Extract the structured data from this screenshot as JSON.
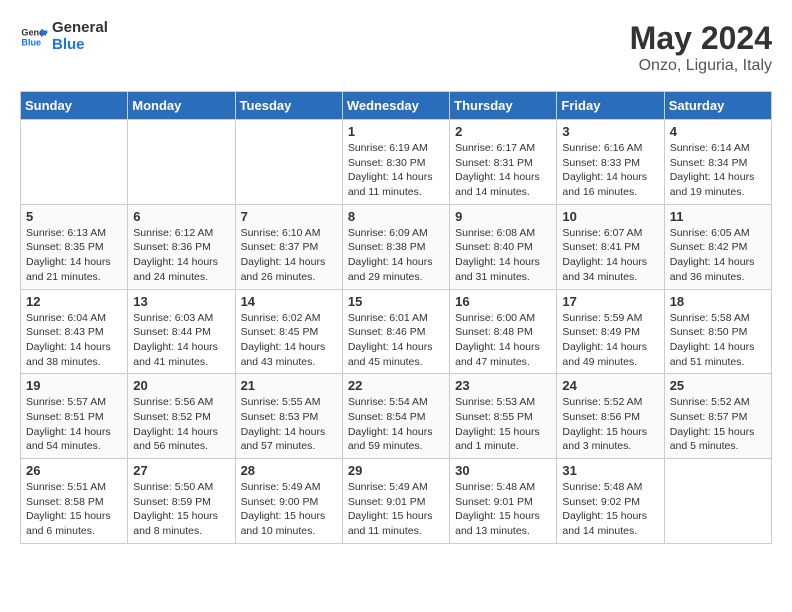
{
  "header": {
    "logo_general": "General",
    "logo_blue": "Blue",
    "month_year": "May 2024",
    "location": "Onzo, Liguria, Italy"
  },
  "days_of_week": [
    "Sunday",
    "Monday",
    "Tuesday",
    "Wednesday",
    "Thursday",
    "Friday",
    "Saturday"
  ],
  "weeks": [
    [
      {
        "day": "",
        "info": ""
      },
      {
        "day": "",
        "info": ""
      },
      {
        "day": "",
        "info": ""
      },
      {
        "day": "1",
        "info": "Sunrise: 6:19 AM\nSunset: 8:30 PM\nDaylight: 14 hours\nand 11 minutes."
      },
      {
        "day": "2",
        "info": "Sunrise: 6:17 AM\nSunset: 8:31 PM\nDaylight: 14 hours\nand 14 minutes."
      },
      {
        "day": "3",
        "info": "Sunrise: 6:16 AM\nSunset: 8:33 PM\nDaylight: 14 hours\nand 16 minutes."
      },
      {
        "day": "4",
        "info": "Sunrise: 6:14 AM\nSunset: 8:34 PM\nDaylight: 14 hours\nand 19 minutes."
      }
    ],
    [
      {
        "day": "5",
        "info": "Sunrise: 6:13 AM\nSunset: 8:35 PM\nDaylight: 14 hours\nand 21 minutes."
      },
      {
        "day": "6",
        "info": "Sunrise: 6:12 AM\nSunset: 8:36 PM\nDaylight: 14 hours\nand 24 minutes."
      },
      {
        "day": "7",
        "info": "Sunrise: 6:10 AM\nSunset: 8:37 PM\nDaylight: 14 hours\nand 26 minutes."
      },
      {
        "day": "8",
        "info": "Sunrise: 6:09 AM\nSunset: 8:38 PM\nDaylight: 14 hours\nand 29 minutes."
      },
      {
        "day": "9",
        "info": "Sunrise: 6:08 AM\nSunset: 8:40 PM\nDaylight: 14 hours\nand 31 minutes."
      },
      {
        "day": "10",
        "info": "Sunrise: 6:07 AM\nSunset: 8:41 PM\nDaylight: 14 hours\nand 34 minutes."
      },
      {
        "day": "11",
        "info": "Sunrise: 6:05 AM\nSunset: 8:42 PM\nDaylight: 14 hours\nand 36 minutes."
      }
    ],
    [
      {
        "day": "12",
        "info": "Sunrise: 6:04 AM\nSunset: 8:43 PM\nDaylight: 14 hours\nand 38 minutes."
      },
      {
        "day": "13",
        "info": "Sunrise: 6:03 AM\nSunset: 8:44 PM\nDaylight: 14 hours\nand 41 minutes."
      },
      {
        "day": "14",
        "info": "Sunrise: 6:02 AM\nSunset: 8:45 PM\nDaylight: 14 hours\nand 43 minutes."
      },
      {
        "day": "15",
        "info": "Sunrise: 6:01 AM\nSunset: 8:46 PM\nDaylight: 14 hours\nand 45 minutes."
      },
      {
        "day": "16",
        "info": "Sunrise: 6:00 AM\nSunset: 8:48 PM\nDaylight: 14 hours\nand 47 minutes."
      },
      {
        "day": "17",
        "info": "Sunrise: 5:59 AM\nSunset: 8:49 PM\nDaylight: 14 hours\nand 49 minutes."
      },
      {
        "day": "18",
        "info": "Sunrise: 5:58 AM\nSunset: 8:50 PM\nDaylight: 14 hours\nand 51 minutes."
      }
    ],
    [
      {
        "day": "19",
        "info": "Sunrise: 5:57 AM\nSunset: 8:51 PM\nDaylight: 14 hours\nand 54 minutes."
      },
      {
        "day": "20",
        "info": "Sunrise: 5:56 AM\nSunset: 8:52 PM\nDaylight: 14 hours\nand 56 minutes."
      },
      {
        "day": "21",
        "info": "Sunrise: 5:55 AM\nSunset: 8:53 PM\nDaylight: 14 hours\nand 57 minutes."
      },
      {
        "day": "22",
        "info": "Sunrise: 5:54 AM\nSunset: 8:54 PM\nDaylight: 14 hours\nand 59 minutes."
      },
      {
        "day": "23",
        "info": "Sunrise: 5:53 AM\nSunset: 8:55 PM\nDaylight: 15 hours\nand 1 minute."
      },
      {
        "day": "24",
        "info": "Sunrise: 5:52 AM\nSunset: 8:56 PM\nDaylight: 15 hours\nand 3 minutes."
      },
      {
        "day": "25",
        "info": "Sunrise: 5:52 AM\nSunset: 8:57 PM\nDaylight: 15 hours\nand 5 minutes."
      }
    ],
    [
      {
        "day": "26",
        "info": "Sunrise: 5:51 AM\nSunset: 8:58 PM\nDaylight: 15 hours\nand 6 minutes."
      },
      {
        "day": "27",
        "info": "Sunrise: 5:50 AM\nSunset: 8:59 PM\nDaylight: 15 hours\nand 8 minutes."
      },
      {
        "day": "28",
        "info": "Sunrise: 5:49 AM\nSunset: 9:00 PM\nDaylight: 15 hours\nand 10 minutes."
      },
      {
        "day": "29",
        "info": "Sunrise: 5:49 AM\nSunset: 9:01 PM\nDaylight: 15 hours\nand 11 minutes."
      },
      {
        "day": "30",
        "info": "Sunrise: 5:48 AM\nSunset: 9:01 PM\nDaylight: 15 hours\nand 13 minutes."
      },
      {
        "day": "31",
        "info": "Sunrise: 5:48 AM\nSunset: 9:02 PM\nDaylight: 15 hours\nand 14 minutes."
      },
      {
        "day": "",
        "info": ""
      }
    ]
  ]
}
